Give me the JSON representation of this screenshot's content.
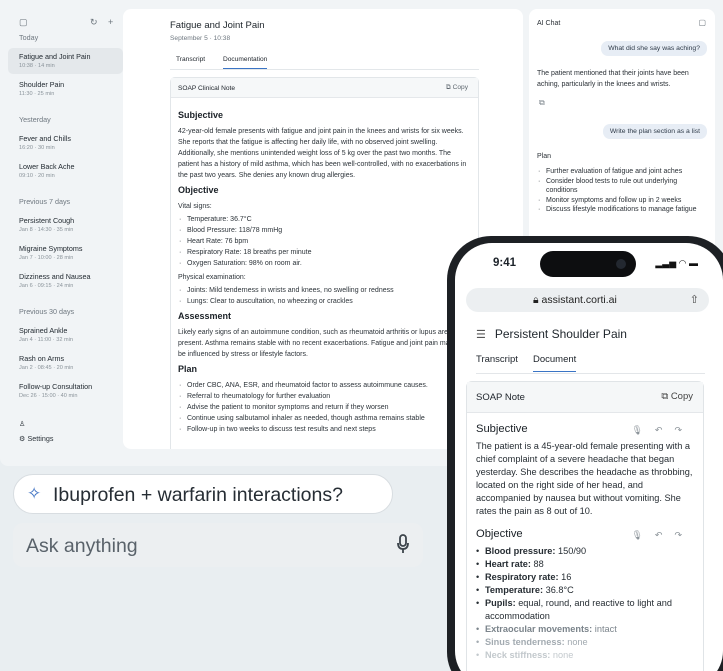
{
  "sidebar": {
    "sections": [
      {
        "title": "Today",
        "items": [
          {
            "title": "Fatigue and Joint Pain",
            "meta": "10:38 · 14 min",
            "active": true
          },
          {
            "title": "Shoulder Pain",
            "meta": "11:30 · 25 min"
          }
        ]
      },
      {
        "title": "Yesterday",
        "items": [
          {
            "title": "Fever and Chills",
            "meta": "16:20 · 30 min"
          },
          {
            "title": "Lower Back Ache",
            "meta": "09:10 · 20 min"
          }
        ]
      },
      {
        "title": "Previous 7 days",
        "items": [
          {
            "title": "Persistent Cough",
            "meta": "Jan 8 · 14:30 · 35 min"
          },
          {
            "title": "Migraine Symptoms",
            "meta": "Jan 7 · 10:00 · 28 min"
          },
          {
            "title": "Dizziness and Nausea",
            "meta": "Jan 6 · 09:15 · 24 min"
          }
        ]
      },
      {
        "title": "Previous 30 days",
        "items": [
          {
            "title": "Sprained Ankle",
            "meta": "Jan 4 · 11:00 · 32 min"
          },
          {
            "title": "Rash on Arms",
            "meta": "Jan 2 · 08:45 · 20 min"
          },
          {
            "title": "Follow-up Consultation",
            "meta": "Dec 26 · 15:00 · 40 min"
          }
        ]
      }
    ],
    "settings_label": "Settings"
  },
  "main": {
    "title": "Fatigue and Joint Pain",
    "date": "September 5 · 10:38",
    "tabs": [
      "Transcript",
      "Documentation"
    ],
    "card_title": "SOAP Clinical Note",
    "copy_label": "Copy",
    "subjective_title": "Subjective",
    "subjective_text": "42-year-old female presents with fatigue and joint pain in the knees and wrists for six weeks. She reports that the fatigue is affecting her daily life, with no observed joint swelling. Additionally, she mentions unintended weight loss of 5 kg over the past two months. The patient has a history of mild asthma, which has been well-controlled, with no exacerbations in the past two years. She denies any known drug allergies.",
    "objective_title": "Objective",
    "vitals_label": "Vital signs:",
    "vitals": [
      "Temperature: 36.7°C",
      "Blood Pressure: 118/78 mmHg",
      "Heart Rate: 76 bpm",
      "Respiratory Rate: 18 breaths per minute",
      "Oxygen Saturation: 98% on room air."
    ],
    "exam_label": "Physical examination:",
    "exam": [
      "Joints: Mild tenderness in wrists and knees, no swelling or redness",
      "Lungs: Clear to auscultation, no wheezing or crackles"
    ],
    "assessment_title": "Assessment",
    "assessment_text": "Likely early signs of an autoimmune condition, such as rheumatoid arthritis or lupus are present. Asthma remains stable with no recent exacerbations. Fatigue and joint pain may also be influenced by stress or lifestyle factors.",
    "plan_title": "Plan",
    "plan": [
      "Order CBC, ANA, ESR, and rheumatoid factor to assess autoimmune causes.",
      "Referral to rheumatology for further evaluation",
      "Advise the patient to monitor symptoms and return if they worsen",
      "Continue using salbutamol inhaler as needed, though asthma remains stable",
      "Follow-up in two weeks to discuss test results and next steps"
    ]
  },
  "chat": {
    "title": "AI Chat",
    "q1": "What did she say was aching?",
    "a1": "The patient mentioned that their joints have been aching, particularly in the knees and wrists.",
    "q2": "Write the plan section as a list",
    "plan_title": "Plan",
    "plan": [
      "Further evaluation of fatigue and joint aches",
      "Consider blood tests to rule out underlying conditions",
      "Monitor symptoms and follow up in 2 weeks",
      "Discuss lifestyle modifications to manage fatigue"
    ]
  },
  "overlay": {
    "suggestion": "Ibuprofen + warfarin interactions?",
    "ask_placeholder": "Ask anything"
  },
  "phone": {
    "time": "9:41",
    "url": "assistant.corti.ai",
    "title": "Persistent Shoulder Pain",
    "tabs": [
      "Transcript",
      "Document"
    ],
    "card_title": "SOAP Note",
    "copy_label": "Copy",
    "subjective_title": "Subjective",
    "subjective_text": "The patient is a 45-year-old female presenting with a chief complaint of a severe headache that began yesterday. She describes the headache as throbbing, located on the right side of her head, and accompanied by nausea but without vomiting. She rates the pain as 8 out of 10.",
    "objective_title": "Objective",
    "objective": [
      {
        "k": "Blood pressure:",
        "v": " 150/90"
      },
      {
        "k": "Heart rate:",
        "v": " 88"
      },
      {
        "k": "Respiratory rate:",
        "v": " 16"
      },
      {
        "k": "Temperature:",
        "v": " 36.8°C"
      },
      {
        "k": "Pupils:",
        "v": " equal, round, and reactive to light and accommodation"
      },
      {
        "k": "Extraocular movements:",
        "v": " intact"
      },
      {
        "k": "Sinus tenderness:",
        "v": " none"
      },
      {
        "k": "Neck stiffness:",
        "v": " none"
      }
    ]
  }
}
